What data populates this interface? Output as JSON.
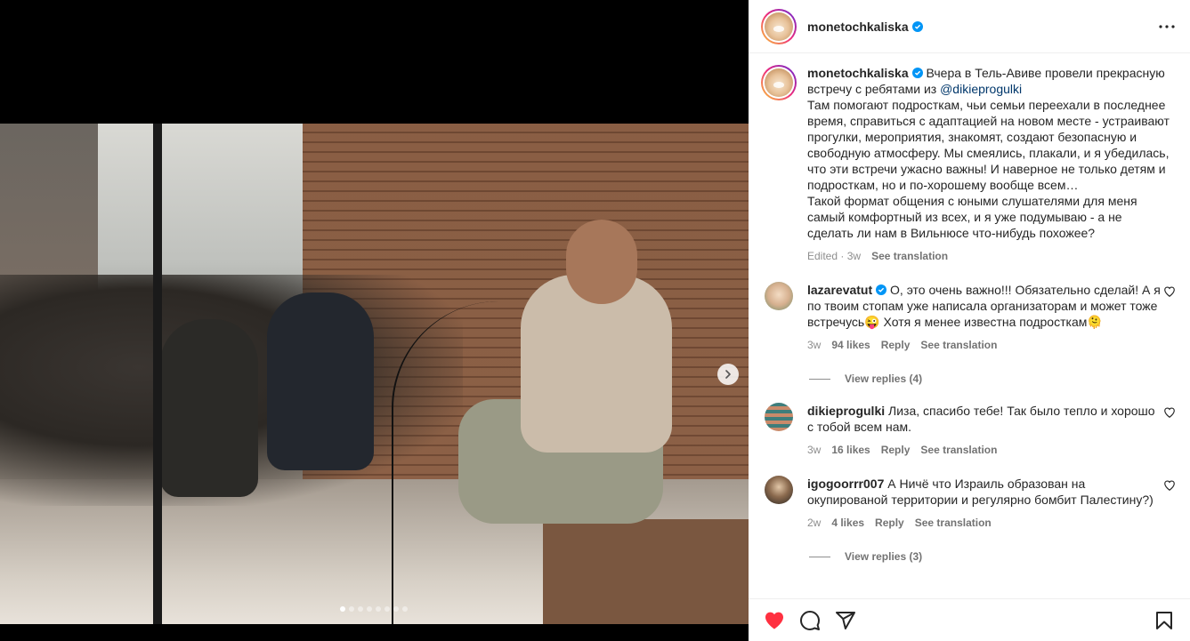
{
  "post": {
    "author": "monetochkaliska",
    "caption_intro": "Вчера в Тель-Авиве провели прекрасную встречу с ребятами из ",
    "caption_mention": "@dikieprogulki",
    "caption_rest": "Там помогают подросткам, чьи семьи переехали в последнее время, справиться с адаптацией на новом месте - устраивают прогулки, мероприятия, знакомят, создают безопасную и свободную атмосферу. Мы смеялись, плакали, и я убедилась, что эти встречи ужасно важны! И наверное не только детям и подросткам, но и по-хорошему вообще всем…",
    "caption_rest2": "Такой формат общения с юными слушателями для меня самый комфортный из всех, и я уже подумываю - а не сделать ли нам в Вильнюсе что-нибудь похожее?",
    "edited": "Edited",
    "sep": "·",
    "age": "3w",
    "see_translation": "See translation"
  },
  "carousel": {
    "total": 8,
    "active": 0
  },
  "comments": [
    {
      "user": "lazarevatut",
      "verified": true,
      "text": "О, это очень важно!!! Обязательно сделай! А я по твоим стопам уже написала организаторам и может тоже встречусь😜 Хотя я менее известна подросткам🫠",
      "age": "3w",
      "likes": "94 likes",
      "reply": "Reply",
      "see_translation": "See translation",
      "view_replies": "View replies (4)"
    },
    {
      "user": "dikieprogulki",
      "verified": false,
      "text": "Лиза, спасибо тебе! Так было тепло и хорошо с тобой всем нам.",
      "age": "3w",
      "likes": "16 likes",
      "reply": "Reply",
      "see_translation": "See translation"
    },
    {
      "user": "igogoorrr007",
      "verified": false,
      "text": "А Ничё что Израиль образован на окупированой территории и регулярно бомбит Палестину?)",
      "age": "2w",
      "likes": "4 likes",
      "reply": "Reply",
      "see_translation": "See translation",
      "view_replies": "View replies (3)"
    }
  ],
  "colors": {
    "verified": "#0095f6",
    "liked": "#ff3040",
    "mention": "#00376b"
  },
  "icons": [
    "chevron-right-icon",
    "more-horizontal-icon",
    "verified-badge-icon",
    "heart-icon",
    "comment-icon",
    "share-icon",
    "bookmark-icon"
  ]
}
